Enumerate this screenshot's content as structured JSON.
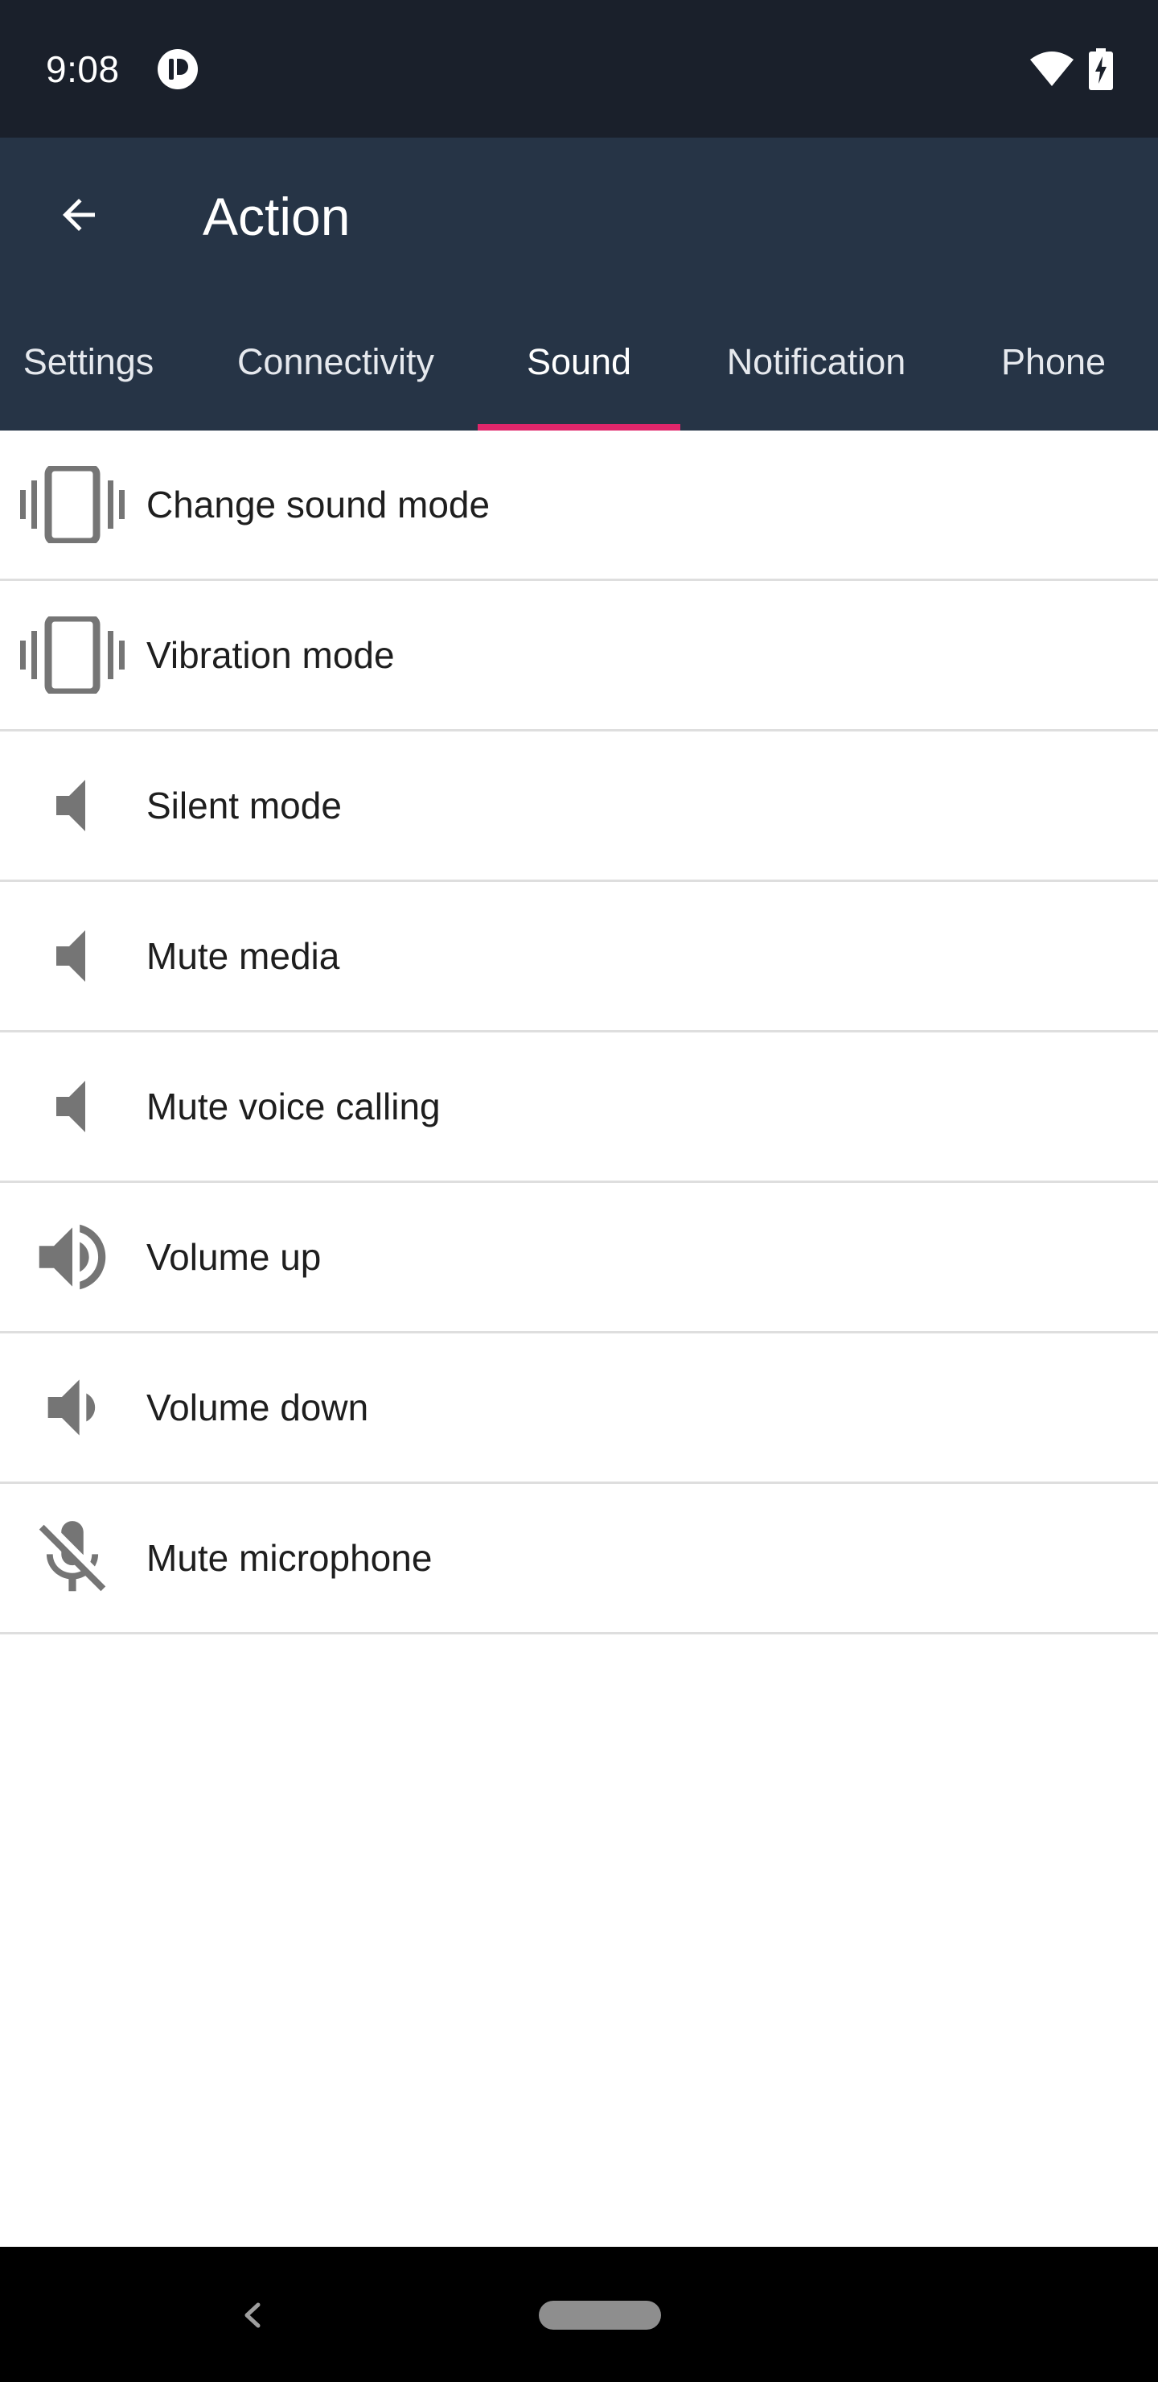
{
  "status_bar": {
    "time": "9:08",
    "icons": [
      "app-notification-icon",
      "wifi-icon",
      "battery-charging-icon"
    ]
  },
  "app_bar": {
    "title": "Action",
    "back_icon": "arrow-back-icon"
  },
  "tabs": [
    {
      "label": "Settings",
      "active": false
    },
    {
      "label": "Connectivity",
      "active": false
    },
    {
      "label": "Sound",
      "active": true
    },
    {
      "label": "Notification",
      "active": false
    },
    {
      "label": "Phone",
      "active": false
    }
  ],
  "list": {
    "items": [
      {
        "label": "Change sound mode",
        "icon": "vibrate-icon"
      },
      {
        "label": "Vibration mode",
        "icon": "vibrate-icon"
      },
      {
        "label": "Silent mode",
        "icon": "speaker-icon"
      },
      {
        "label": "Mute media",
        "icon": "speaker-icon"
      },
      {
        "label": "Mute voice calling",
        "icon": "speaker-icon"
      },
      {
        "label": "Volume up",
        "icon": "volume-up-icon"
      },
      {
        "label": "Volume down",
        "icon": "volume-down-icon"
      },
      {
        "label": "Mute microphone",
        "icon": "mic-off-icon"
      }
    ]
  },
  "colors": {
    "status_bar_bg": "#1a202b",
    "app_bar_bg": "#263446",
    "tab_indicator": "#e0266b",
    "icon_gray": "#757575",
    "divider": "#dedede"
  }
}
